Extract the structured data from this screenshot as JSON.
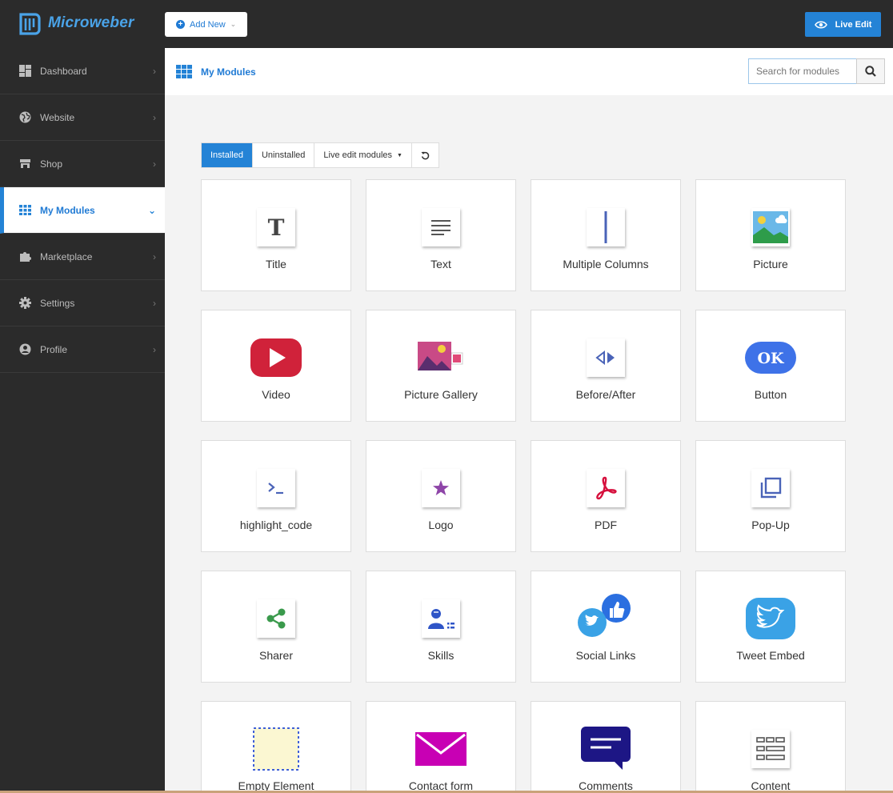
{
  "brand": {
    "name": "Microweber"
  },
  "topbar": {
    "add_new_label": "Add New",
    "live_edit_label": "Live Edit"
  },
  "sidebar": {
    "items": [
      {
        "label": "Dashboard",
        "icon": "dashboard-icon"
      },
      {
        "label": "Website",
        "icon": "globe-icon"
      },
      {
        "label": "Shop",
        "icon": "shop-icon"
      },
      {
        "label": "My Modules",
        "icon": "modules-grid-icon",
        "active": true
      },
      {
        "label": "Marketplace",
        "icon": "puzzle-icon"
      },
      {
        "label": "Settings",
        "icon": "gear-icon"
      },
      {
        "label": "Profile",
        "icon": "user-icon"
      }
    ]
  },
  "main": {
    "title": "My Modules",
    "search": {
      "placeholder": "Search for modules"
    },
    "tabs": [
      {
        "label": "Installed",
        "active": true
      },
      {
        "label": "Uninstalled"
      },
      {
        "label": "Live edit modules"
      }
    ],
    "modules": [
      {
        "label": "Title",
        "icon": "title-icon"
      },
      {
        "label": "Text",
        "icon": "text-icon"
      },
      {
        "label": "Multiple Columns",
        "icon": "columns-icon"
      },
      {
        "label": "Picture",
        "icon": "picture-icon"
      },
      {
        "label": "Video",
        "icon": "video-icon"
      },
      {
        "label": "Picture Gallery",
        "icon": "gallery-icon"
      },
      {
        "label": "Before/After",
        "icon": "before-after-icon"
      },
      {
        "label": "Button",
        "icon": "button-icon"
      },
      {
        "label": "highlight_code",
        "icon": "code-icon"
      },
      {
        "label": "Logo",
        "icon": "logo-icon"
      },
      {
        "label": "PDF",
        "icon": "pdf-icon"
      },
      {
        "label": "Pop-Up",
        "icon": "popup-icon"
      },
      {
        "label": "Sharer",
        "icon": "share-icon"
      },
      {
        "label": "Skills",
        "icon": "skills-icon"
      },
      {
        "label": "Social Links",
        "icon": "social-links-icon"
      },
      {
        "label": "Tweet Embed",
        "icon": "twitter-icon"
      },
      {
        "label": "Empty Element",
        "icon": "empty-element-icon"
      },
      {
        "label": "Contact form",
        "icon": "envelope-icon"
      },
      {
        "label": "Comments",
        "icon": "comments-icon"
      },
      {
        "label": "Content",
        "icon": "content-icon"
      }
    ]
  },
  "colors": {
    "accent": "#2483d6",
    "sidebar_bg": "#2b2b2b",
    "main_bg": "#f3f3f3"
  }
}
